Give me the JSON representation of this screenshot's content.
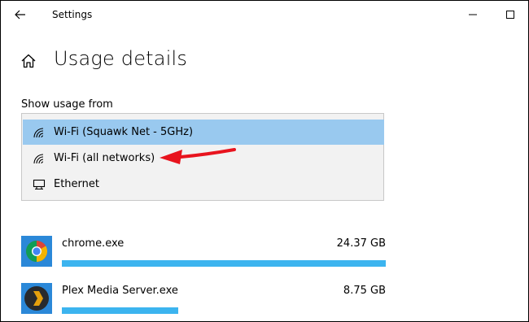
{
  "window": {
    "title": "Settings"
  },
  "page": {
    "title": "Usage details"
  },
  "usage": {
    "label": "Show usage from",
    "options": [
      {
        "label": "Wi-Fi (Squawk Net - 5GHz)",
        "icon": "wifi-icon",
        "selected": true
      },
      {
        "label": "Wi-Fi (all networks)",
        "icon": "wifi-icon",
        "selected": false
      },
      {
        "label": "Ethernet",
        "icon": "ethernet-icon",
        "selected": false
      }
    ]
  },
  "apps": [
    {
      "name": "chrome.exe",
      "size": "24.37 GB",
      "icon": "chrome-icon",
      "usage_fraction": 1.0
    },
    {
      "name": "Plex Media Server.exe",
      "size": "8.75 GB",
      "icon": "plex-icon",
      "usage_fraction": 0.36
    }
  ],
  "colors": {
    "selected_bg": "#99c9ef",
    "bar": "#3cb4ef",
    "arrow": "#e8141e"
  }
}
